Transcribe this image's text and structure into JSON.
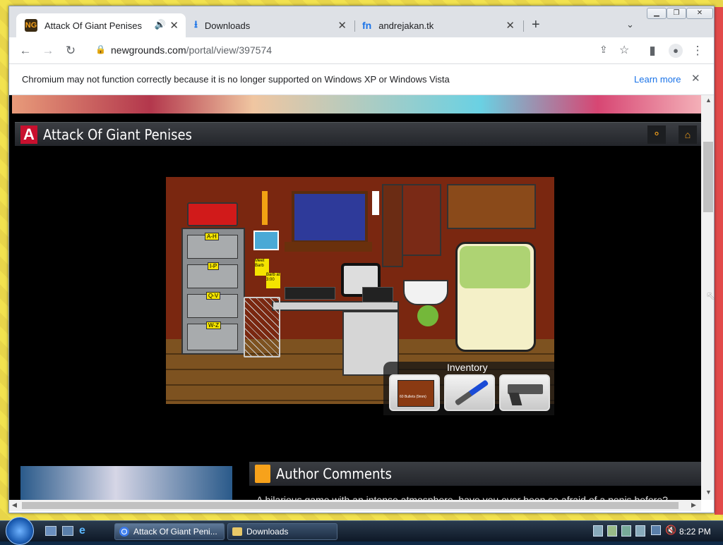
{
  "browser": {
    "tabs": [
      {
        "title": "Attack Of Giant Penises",
        "favicon": "newgrounds-icon",
        "audio": true,
        "active": true
      },
      {
        "title": "Downloads",
        "favicon": "download-icon",
        "active": false
      },
      {
        "title": "andrejakan.tk",
        "favicon": "fn-icon",
        "active": false
      }
    ],
    "url_host": "newgrounds.com",
    "url_path": "/portal/view/397574",
    "infobar": {
      "message": "Chromium may not function correctly because it is no longer supported on Windows XP or Windows Vista",
      "link": "Learn more"
    }
  },
  "page": {
    "game_title": "Attack Of Giant Penises",
    "inventory_label": "Inventory",
    "inventory_items": [
      "ammo-box-icon",
      "screwdriver-icon",
      "pistol-icon"
    ],
    "ammo_box_text": "60 Bullets (9mm)",
    "cabinet_labels": [
      "A-H",
      "I-P",
      "Q-V",
      "W-Z"
    ],
    "author_comments_title": "Author Comments",
    "author_comments_text": "A hilarious game with an intense atmosphere, have you ever been so afraid of a penis before?",
    "note_text": "Meet Barb",
    "note2_text": "Barb at 3:00"
  },
  "taskbar": {
    "items": [
      {
        "label": "Attack Of Giant Peni...",
        "icon": "chromium-icon",
        "active": true
      },
      {
        "label": "Downloads",
        "icon": "folder-icon",
        "active": false
      }
    ],
    "clock": "8:22 PM"
  },
  "colors": {
    "accent_red": "#c8102e",
    "tab_strip": "#dee1e6",
    "taskbar": "#1a2738"
  }
}
